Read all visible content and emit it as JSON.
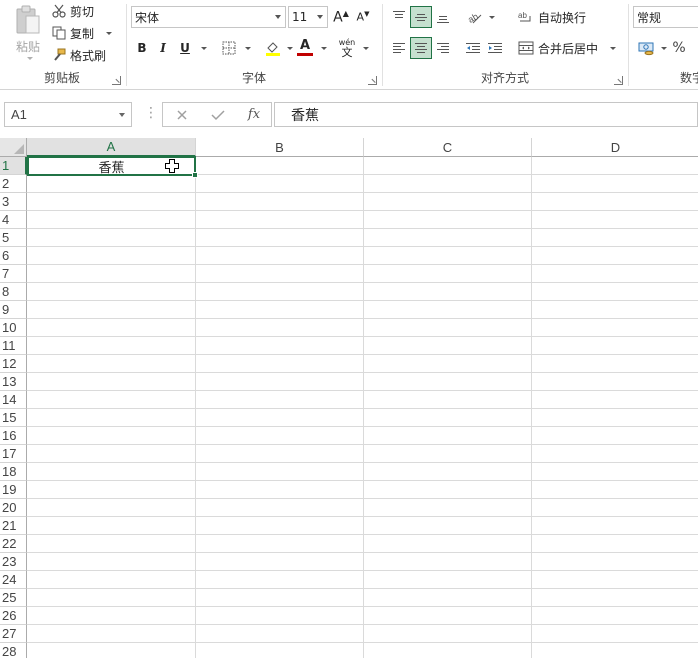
{
  "ribbon": {
    "clipboard": {
      "paste_label": "粘贴",
      "cut_label": "剪切",
      "copy_label": "复制",
      "format_painter_label": "格式刷",
      "group_label": "剪贴板"
    },
    "font": {
      "font_name": "宋体",
      "font_size": "11",
      "bold_label": "B",
      "italic_label": "I",
      "underline_label": "U",
      "font_color_label": "A",
      "phonetic_label": "wén",
      "phonetic_char": "文",
      "group_label": "字体"
    },
    "alignment": {
      "wrap_text_label": "自动换行",
      "merge_center_label": "合并后居中",
      "group_label": "对齐方式"
    },
    "number": {
      "format_value": "常规",
      "percent_label": "%",
      "group_label": "数字"
    }
  },
  "formula_bar": {
    "name_box": "A1",
    "fx_label": "fx",
    "value": "香蕉"
  },
  "sheet": {
    "columns": [
      "A",
      "B",
      "C",
      "D"
    ],
    "rows": [
      "1",
      "2",
      "3",
      "4",
      "5",
      "6",
      "7",
      "8",
      "9",
      "10",
      "11",
      "12",
      "13",
      "14",
      "15",
      "16",
      "17",
      "18",
      "19",
      "20",
      "21",
      "22",
      "23",
      "24",
      "25",
      "26",
      "27",
      "28"
    ],
    "active_cell": "A1",
    "cells": {
      "A1": "香蕉"
    }
  },
  "colors": {
    "accent": "#217346",
    "selected_fill": "#c5e0cf",
    "header_active": "#e1e1e1",
    "gridline": "#dadada"
  }
}
